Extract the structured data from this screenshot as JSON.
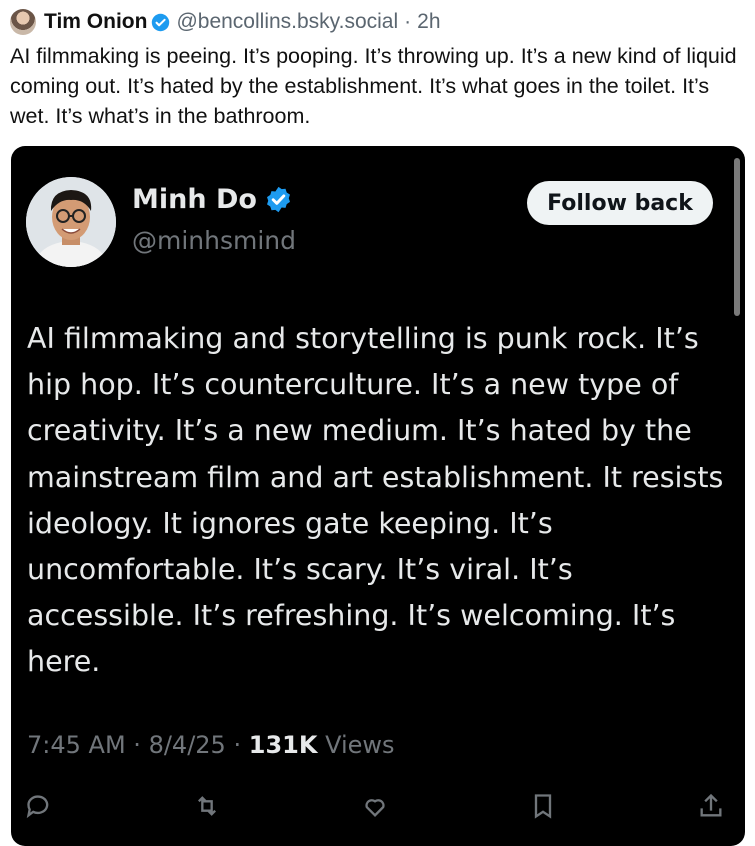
{
  "post": {
    "author_name": "Tim Onion",
    "handle": "@bencollins.bsky.social",
    "separator": "·",
    "time": "2h",
    "text": "AI filmmaking is peeing. It’s pooping. It’s throwing up. It’s a new kind of liquid coming out. It’s hated by the establishment. It’s what goes in the toilet. It’s wet. It’s what’s in the bathroom."
  },
  "embed": {
    "name": "Minh Do",
    "handle": "@minhsmind",
    "follow_label": "Follow back",
    "text": "AI filmmaking and storytelling is punk rock. It’s hip hop. It’s counterculture. It’s a new type of creativity. It’s a new medium. It’s hated by the mainstream film and art establishment. It resists ideology. It ignores gate keeping. It’s uncomfortable. It’s scary. It’s viral. It’s accessible. It’s refreshing. It’s welcoming. It’s here.",
    "time": "7:45 AM",
    "date": "8/4/25",
    "meta_sep": "·",
    "views_count": "131K",
    "views_label": "Views",
    "verified_color": "#1d9bf0",
    "background_color": "#000000"
  },
  "icons": {
    "post_verified": "verified-badge-icon",
    "embed_verified": "verified-badge-icon",
    "actions": [
      "reply-icon",
      "repost-icon",
      "like-icon",
      "bookmark-icon",
      "share-icon"
    ]
  }
}
